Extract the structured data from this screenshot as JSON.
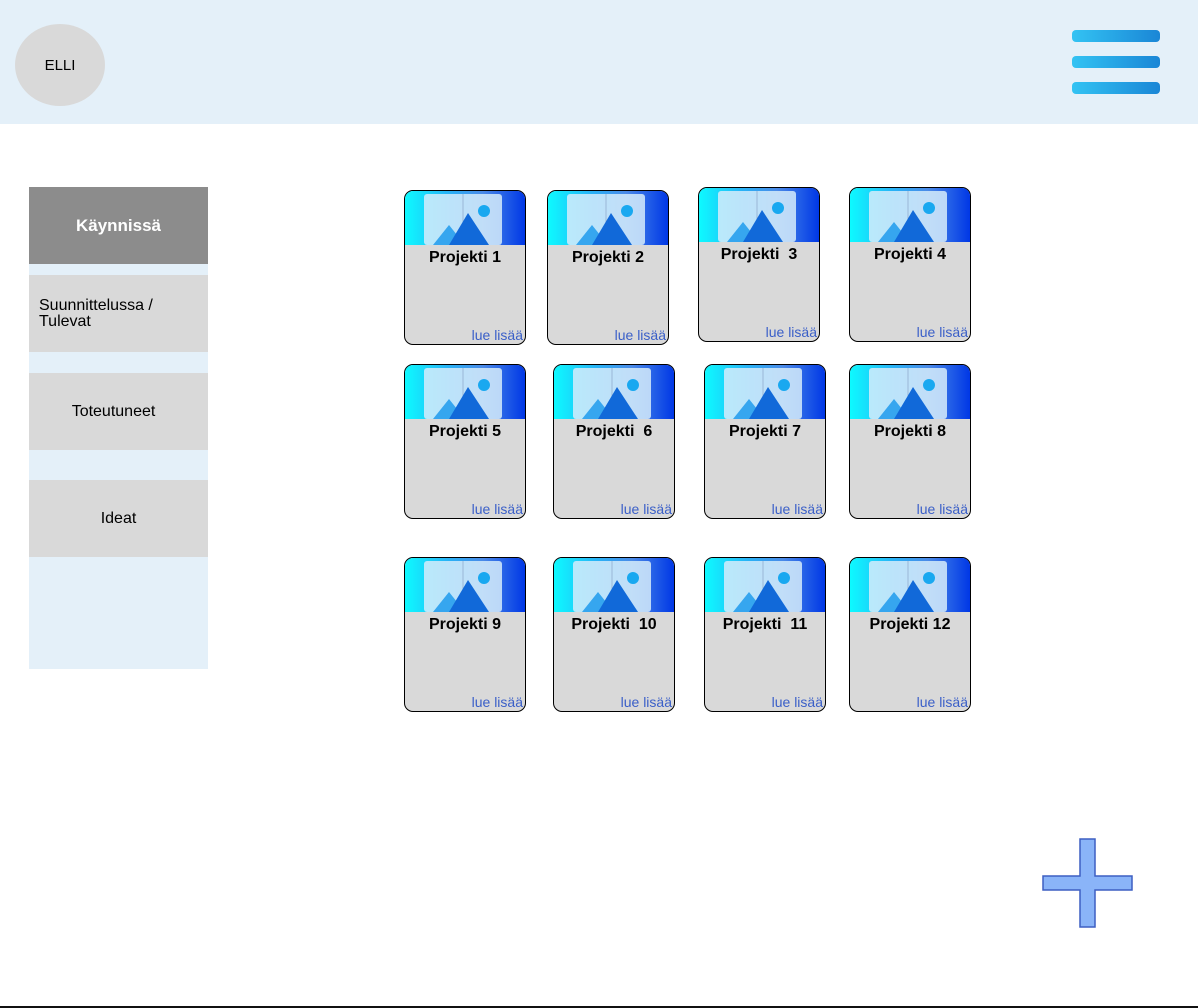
{
  "header": {
    "avatar_label": "ELLI",
    "menu_icon": "hamburger-menu-icon"
  },
  "sidebar": {
    "items": [
      {
        "label": "Käynnissä",
        "active": true
      },
      {
        "label": "Suunnittelussa / Tulevat",
        "active": false
      },
      {
        "label": "Toteutuneet",
        "active": false
      },
      {
        "label": "Ideat",
        "active": false
      }
    ]
  },
  "projects": [
    {
      "title": "Projekti 1",
      "link": "lue lisää"
    },
    {
      "title": "Projekti 2",
      "link": "lue lisää"
    },
    {
      "title": "Projekti  3",
      "link": "lue lisää"
    },
    {
      "title": "Projekti 4",
      "link": "lue lisää"
    },
    {
      "title": "Projekti 5",
      "link": "lue lisää"
    },
    {
      "title": "Projekti  6",
      "link": "lue lisää"
    },
    {
      "title": "Projekti 7",
      "link": "lue lisää"
    },
    {
      "title": "Projekti 8",
      "link": "lue lisää"
    },
    {
      "title": "Projekti 9",
      "link": "lue lisää"
    },
    {
      "title": "Projekti  10",
      "link": "lue lisää"
    },
    {
      "title": "Projekti  11",
      "link": "lue lisää"
    },
    {
      "title": "Projekti 12",
      "link": "lue lisää"
    }
  ],
  "fab": {
    "icon": "plus-icon",
    "color": "#8ab4f8"
  },
  "colors": {
    "header_bg": "#e4f0f9",
    "active_tab": "#8c8c8c",
    "inactive_tab": "#d9d9d9",
    "link": "#3a5fc8"
  }
}
